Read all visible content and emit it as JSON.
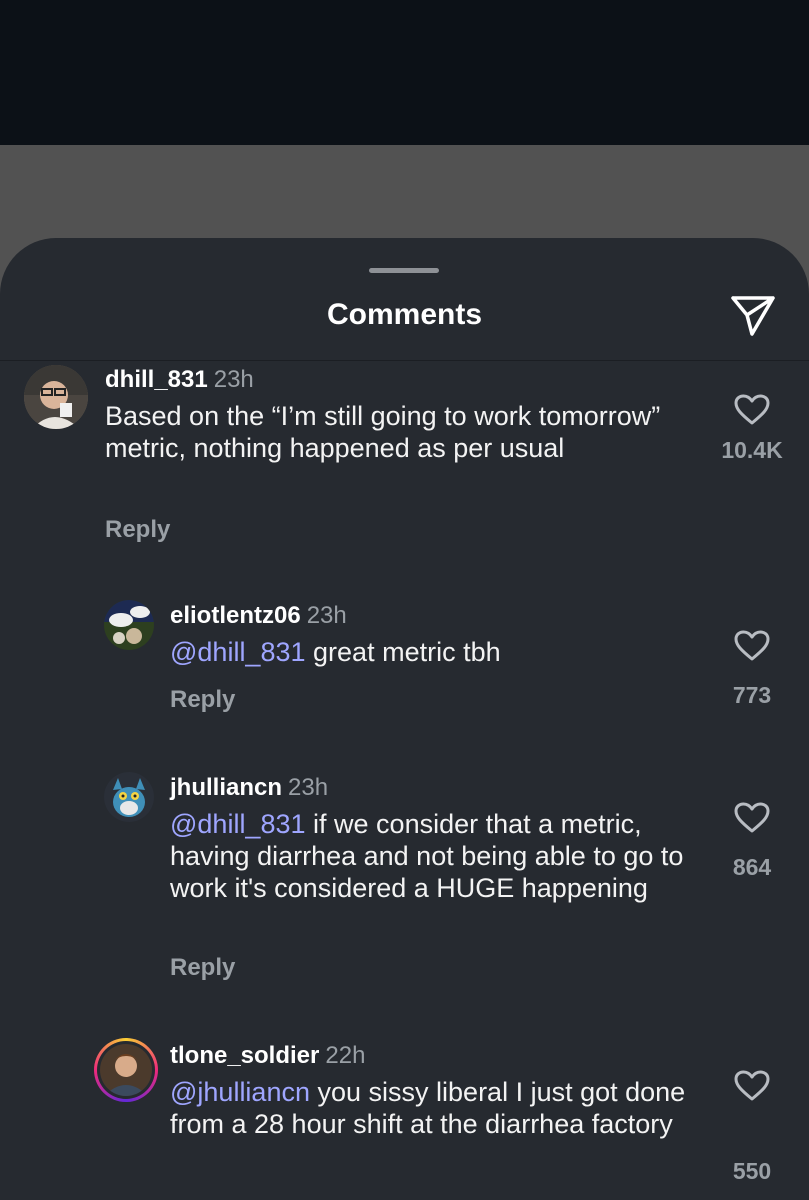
{
  "sheet": {
    "title": "Comments"
  },
  "comments": [
    {
      "username": "dhill_831",
      "time": "23h",
      "mention": "",
      "text": "Based on the “I’m still going to work tomorrow” metric, nothing happened as per usual",
      "reply_label": "Reply",
      "likes": "10.4K"
    },
    {
      "username": "eliotlentz06",
      "time": "23h",
      "mention": "@dhill_831",
      "text": "great metric tbh",
      "reply_label": "Reply",
      "likes": "773"
    },
    {
      "username": "jhulliancn",
      "time": "23h",
      "mention": "@dhill_831",
      "text": "if we consider that a metric, having diarrhea and not being able to go to work it's considered a HUGE happening",
      "reply_label": "Reply",
      "likes": "864"
    },
    {
      "username": "tlone_soldier",
      "time": "22h",
      "mention": "@jhulliancn",
      "text": "you sissy liberal I just got done from a 28 hour shift at the diarrhea factory",
      "reply_label": "",
      "likes": "550"
    }
  ],
  "colors": {
    "mention": "#9fa6ff",
    "sheet_bg": "#262a30",
    "muted": "#9aa0a6",
    "story_ring": "#f5a623"
  },
  "icons": {
    "send": "send-icon",
    "like": "heart-outline-icon"
  }
}
